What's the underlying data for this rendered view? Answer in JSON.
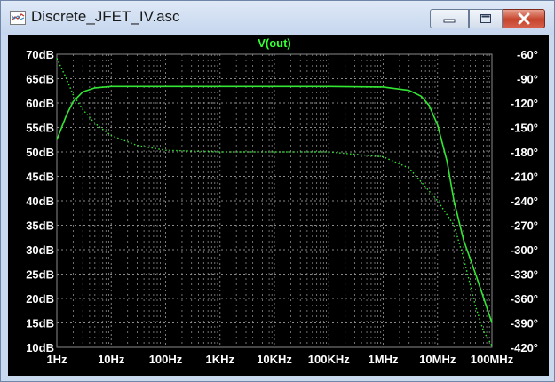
{
  "window": {
    "title": "Discrete_JFET_IV.asc",
    "minimize_icon": "minimize-icon",
    "maximize_icon": "maximize-icon",
    "close_icon": "close-icon"
  },
  "colors": {
    "plot_background": "#000000",
    "trace": "#33e633",
    "grid": "#8a8a8a",
    "axis_text": "#ffffff",
    "title_text": "#33ff33"
  },
  "chart_data": {
    "type": "line",
    "title": "V(out)",
    "x_scale": "log",
    "xlim": [
      1,
      100000000
    ],
    "x_ticks": [
      {
        "value": 1,
        "label": "1Hz"
      },
      {
        "value": 10,
        "label": "10Hz"
      },
      {
        "value": 100,
        "label": "100Hz"
      },
      {
        "value": 1000,
        "label": "1KHz"
      },
      {
        "value": 10000,
        "label": "10KHz"
      },
      {
        "value": 100000,
        "label": "100KHz"
      },
      {
        "value": 1000000,
        "label": "1MHz"
      },
      {
        "value": 10000000,
        "label": "10MHz"
      },
      {
        "value": 100000000,
        "label": "100MHz"
      }
    ],
    "y_left": {
      "lim": [
        10,
        70
      ],
      "ticks": [
        {
          "value": 70,
          "label": "70dB"
        },
        {
          "value": 65,
          "label": "65dB"
        },
        {
          "value": 60,
          "label": "60dB"
        },
        {
          "value": 55,
          "label": "55dB"
        },
        {
          "value": 50,
          "label": "50dB"
        },
        {
          "value": 45,
          "label": "45dB"
        },
        {
          "value": 40,
          "label": "40dB"
        },
        {
          "value": 35,
          "label": "35dB"
        },
        {
          "value": 30,
          "label": "30dB"
        },
        {
          "value": 25,
          "label": "25dB"
        },
        {
          "value": 20,
          "label": "20dB"
        },
        {
          "value": 15,
          "label": "15dB"
        },
        {
          "value": 10,
          "label": "10dB"
        }
      ]
    },
    "y_right": {
      "lim": [
        -420,
        -60
      ],
      "ticks": [
        {
          "value": -60,
          "label": "-60°"
        },
        {
          "value": -90,
          "label": "-90°"
        },
        {
          "value": -120,
          "label": "-120°"
        },
        {
          "value": -150,
          "label": "-150°"
        },
        {
          "value": -180,
          "label": "-180°"
        },
        {
          "value": -210,
          "label": "-210°"
        },
        {
          "value": -240,
          "label": "-240°"
        },
        {
          "value": -270,
          "label": "-270°"
        },
        {
          "value": -300,
          "label": "-300°"
        },
        {
          "value": -330,
          "label": "-330°"
        },
        {
          "value": -360,
          "label": "-360°"
        },
        {
          "value": -390,
          "label": "-390°"
        },
        {
          "value": -420,
          "label": "-420°"
        }
      ]
    },
    "grid": true,
    "series": [
      {
        "name": "V(out)",
        "axis": "left",
        "style": "solid",
        "x": [
          1,
          1.5,
          2,
          3,
          5,
          10,
          100,
          1000,
          10000,
          100000,
          1000000,
          3000000,
          5000000,
          7000000,
          10000000,
          15000000,
          20000000,
          30000000,
          50000000,
          100000000
        ],
        "values": [
          52.5,
          57.5,
          60.3,
          62.3,
          63.1,
          63.4,
          63.4,
          63.4,
          63.4,
          63.4,
          63.3,
          62.6,
          61.4,
          59.5,
          55.5,
          48,
          40,
          32,
          25,
          15
        ]
      },
      {
        "name": "",
        "axis": "right",
        "style": "dotted",
        "x": [
          1,
          1.5,
          2,
          3,
          5,
          10,
          30,
          100,
          1000,
          10000,
          100000,
          1000000,
          3000000,
          10000000,
          20000000,
          30000000,
          50000000,
          70000000,
          100000000
        ],
        "values": [
          -65,
          -90,
          -110,
          -128,
          -145,
          -160,
          -172,
          -178,
          -180,
          -180,
          -180,
          -186,
          -200,
          -240,
          -270,
          -310,
          -370,
          -400,
          -418
        ]
      }
    ]
  }
}
